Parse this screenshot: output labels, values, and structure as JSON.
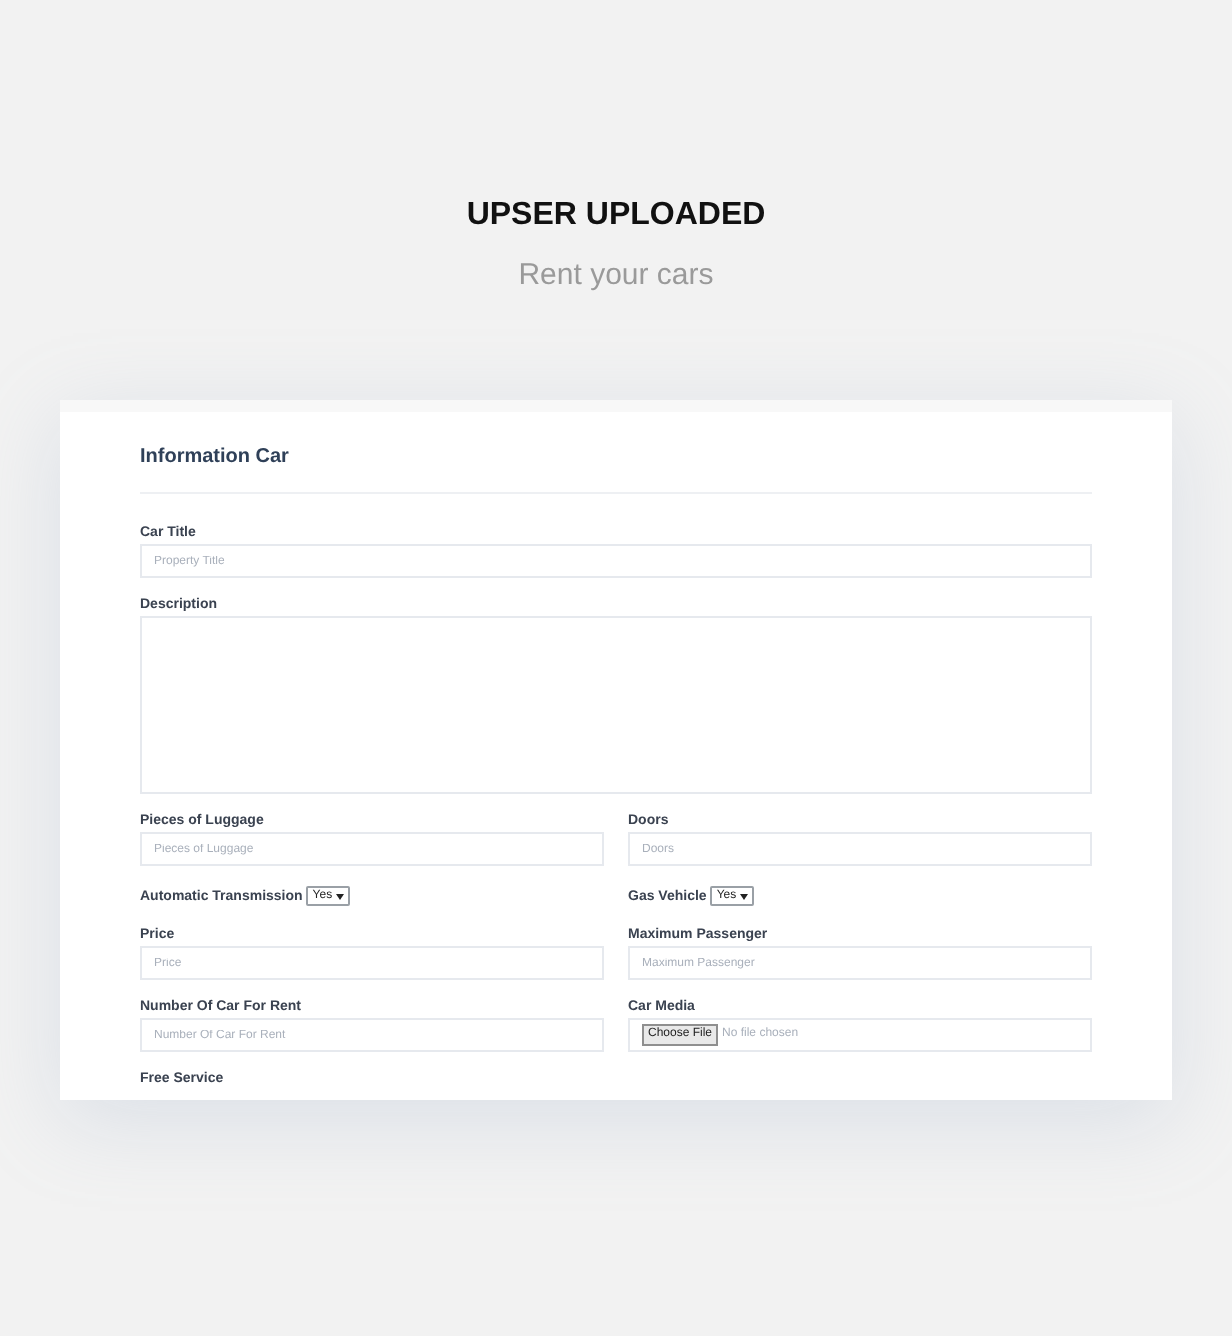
{
  "header": {
    "title": "UPSER UPLOADED",
    "subtitle": "Rent your cars"
  },
  "form": {
    "title": "Information Car",
    "rows": [
      [
        {
          "kind": "text",
          "label": "Car Title",
          "placeholder": "Property Title"
        }
      ],
      [
        {
          "kind": "textarea",
          "label": "Description"
        }
      ],
      [
        {
          "kind": "text",
          "label": "Pieces of Luggage",
          "placeholder": "Pieces of Luggage"
        },
        {
          "kind": "text",
          "label": "Doors",
          "placeholder": "Doors"
        }
      ],
      [
        {
          "kind": "select",
          "label": "Automatic Transmission",
          "value": "Yes"
        },
        {
          "kind": "select",
          "label": "Gas Vehicle",
          "value": "Yes"
        }
      ],
      [
        {
          "kind": "text",
          "label": "Price",
          "placeholder": "Price"
        },
        {
          "kind": "text",
          "label": "Maximum Passenger",
          "placeholder": "Maximum Passenger"
        }
      ],
      [
        {
          "kind": "text",
          "label": "Number Of Car For Rent",
          "placeholder": "Number Of Car For Rent"
        },
        {
          "kind": "file",
          "label": "Car Media",
          "button": "Choose File",
          "value": "No file chosen"
        }
      ],
      [
        {
          "kind": "label",
          "label": "Free Service"
        }
      ]
    ]
  }
}
